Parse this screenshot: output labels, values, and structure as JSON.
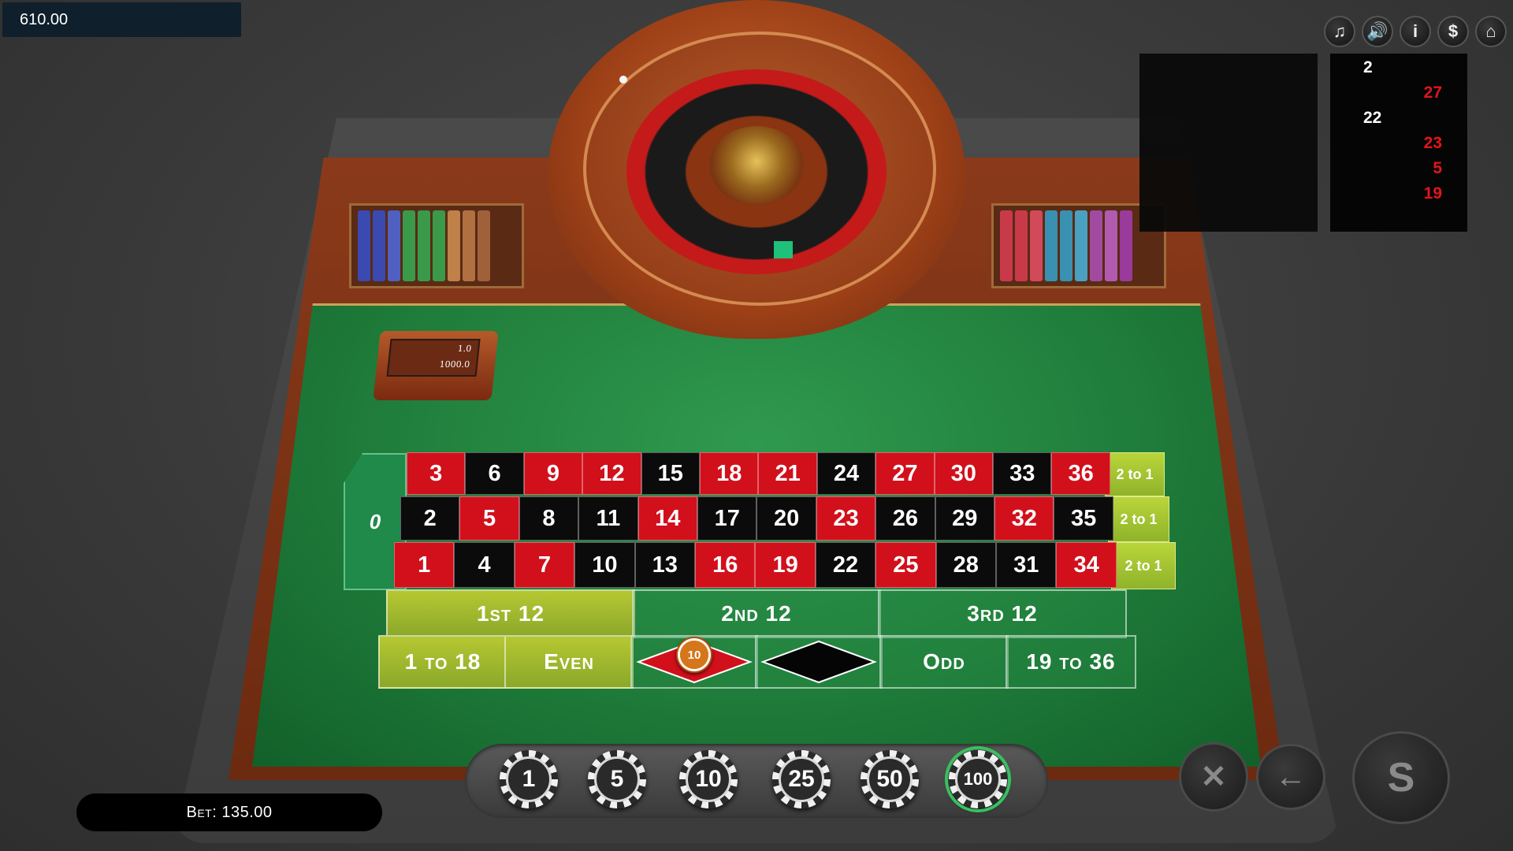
{
  "balance": "610.00",
  "top_icons": [
    "music-icon",
    "sound-icon",
    "info-icon",
    "dollar-icon",
    "home-icon"
  ],
  "top_icon_glyphs": [
    "♫",
    "🔊",
    "i",
    "$",
    "⌂"
  ],
  "history": [
    {
      "value": "2",
      "color": "black"
    },
    {
      "value": "27",
      "color": "red"
    },
    {
      "value": "22",
      "color": "black"
    },
    {
      "value": "23",
      "color": "red"
    },
    {
      "value": "5",
      "color": "red"
    },
    {
      "value": "19",
      "color": "red"
    }
  ],
  "limits": {
    "min": "1.0",
    "max": "1000.0"
  },
  "zero_label": "0",
  "numbers": {
    "row_top": [
      "3",
      "6",
      "9",
      "12",
      "15",
      "18",
      "21",
      "24",
      "27",
      "30",
      "33",
      "36"
    ],
    "row_mid": [
      "2",
      "5",
      "8",
      "11",
      "14",
      "17",
      "20",
      "23",
      "26",
      "29",
      "32",
      "35"
    ],
    "row_bot": [
      "1",
      "4",
      "7",
      "10",
      "13",
      "16",
      "19",
      "22",
      "25",
      "28",
      "31",
      "34"
    ]
  },
  "red_numbers": [
    "1",
    "3",
    "5",
    "7",
    "9",
    "12",
    "14",
    "16",
    "18",
    "19",
    "21",
    "23",
    "25",
    "27",
    "30",
    "32",
    "34",
    "36"
  ],
  "column_bets": [
    "2 to 1",
    "2 to 1",
    "2 to 1"
  ],
  "dozens": [
    "1st 12",
    "2nd 12",
    "3rd 12"
  ],
  "outside": {
    "low": "1 to 18",
    "even": "Even",
    "odd": "Odd",
    "high": "19 to 36"
  },
  "placed_chip": "10",
  "chips": [
    "1",
    "5",
    "10",
    "25",
    "50",
    "100"
  ],
  "selected_chip": "100",
  "buttons": {
    "clear": "✕",
    "undo": "←",
    "spin": "S"
  },
  "bet": "Bet: 135.00",
  "colors": {
    "red": "#d1101c",
    "black": "#0b0b0b",
    "felt": "#1f7c3a",
    "highlight": "#b6c832"
  }
}
